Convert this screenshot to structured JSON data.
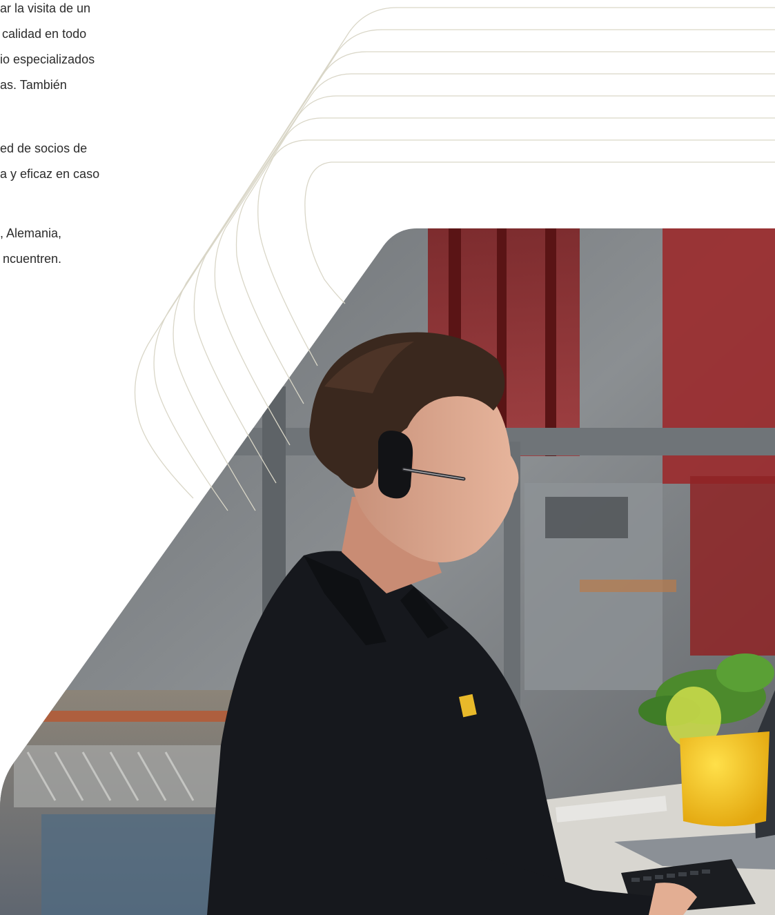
{
  "text_block": {
    "paragraph_1": [
      "ar la visita de un",
      "calidad en todo",
      "io especializados",
      "as. También"
    ],
    "paragraph_2": [
      "ed de socios de",
      "a y eficaz en caso"
    ],
    "paragraph_3": [
      ", Alemania,",
      "ncuentren."
    ]
  },
  "photo": {
    "subject": "technician-with-headset",
    "description": ""
  },
  "colors": {
    "text": "#2b2b2b",
    "line_art": "#d9d6c7",
    "shirt": "#15171c",
    "plant_pot": "#f2c318",
    "background": "#ffffff"
  }
}
